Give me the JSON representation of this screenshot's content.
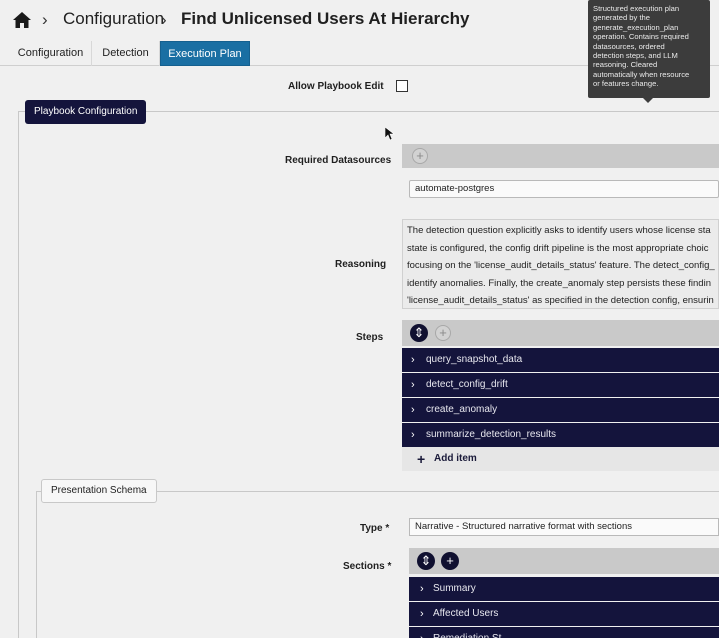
{
  "header": {
    "breadcrumb_1": "Configuration",
    "breadcrumb_2": "Find Unlicensed Users At Hierarchy",
    "home_icon": "home-icon"
  },
  "tabs": [
    {
      "label": "Configuration",
      "active": false
    },
    {
      "label": "Detection",
      "active": false
    },
    {
      "label": "Execution Plan",
      "active": true
    }
  ],
  "tooltip": {
    "text_lines": [
      "Structured execution plan",
      "generated by the",
      "generate_execution_plan",
      "operation. Contains required",
      "datasources, ordered",
      "detection steps, and LLM",
      "reasoning. Cleared",
      "automatically when resource",
      "or features change."
    ]
  },
  "allow_edit": {
    "label": "Allow Playbook Edit",
    "checked": false
  },
  "playbook_section": {
    "label": "Playbook Configuration"
  },
  "datasources": {
    "label": "Required Datasources",
    "values": [
      "automate-postgres"
    ]
  },
  "reasoning": {
    "label": "Reasoning",
    "lines": [
      "The detection question explicitly asks to identify users whose license sta",
      "state is configured, the config drift pipeline is the most appropriate choic",
      "focusing on the 'license_audit_details_status' feature. The detect_config_",
      "identify anomalies. Finally, the create_anomaly step persists these findin",
      "'license_audit_details_status' as specified in the detection config, ensurin"
    ]
  },
  "steps": {
    "label": "Steps",
    "items": [
      "query_snapshot_data",
      "detect_config_drift",
      "create_anomaly",
      "summarize_detection_results"
    ],
    "add_label": "Add item"
  },
  "presentation": {
    "section_label": "Presentation Schema",
    "type_label": "Type *",
    "type_value": "Narrative - Structured narrative format with sections",
    "sections_label": "Sections *",
    "section_items": [
      "Summary",
      "Affected Users",
      "Remediation St"
    ]
  },
  "colors": {
    "accent_tab": "#1a6fa3",
    "dark_navy": "#14143c",
    "tooltip_bg": "#3c3c3c"
  }
}
